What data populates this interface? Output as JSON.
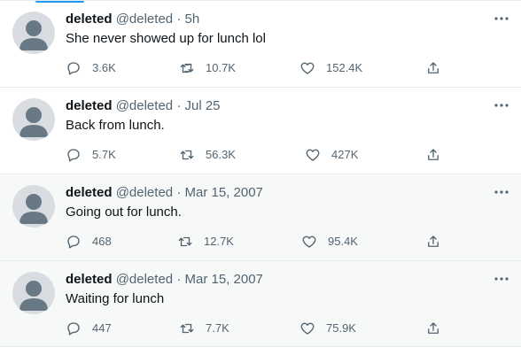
{
  "tweets": [
    {
      "name": "deleted",
      "handle": "@deleted",
      "dot": "·",
      "time": "5h",
      "text": "She never showed up for lunch lol",
      "replies": "3.6K",
      "retweets": "10.7K",
      "likes": "152.4K",
      "shaded": false
    },
    {
      "name": "deleted",
      "handle": "@deleted",
      "dot": "·",
      "time": "Jul 25",
      "text": "Back from lunch.",
      "replies": "5.7K",
      "retweets": "56.3K",
      "likes": "427K",
      "shaded": false
    },
    {
      "name": "deleted",
      "handle": "@deleted",
      "dot": "·",
      "time": "Mar 15, 2007",
      "text": "Going out for lunch.",
      "replies": "468",
      "retweets": "12.7K",
      "likes": "95.4K",
      "shaded": true
    },
    {
      "name": "deleted",
      "handle": "@deleted",
      "dot": "·",
      "time": "Mar 15, 2007",
      "text": "Waiting for lunch",
      "replies": "447",
      "retweets": "7.7K",
      "likes": "75.9K",
      "shaded": true
    }
  ],
  "icons": {
    "reply": "reply-icon",
    "retweet": "retweet-icon",
    "like": "heart-icon",
    "share": "share-icon",
    "more": "more-dots-icon",
    "avatar": "default-avatar-icon"
  },
  "colors": {
    "accent": "#1d9bf0",
    "text": "#0f1419",
    "secondary": "#536471"
  }
}
